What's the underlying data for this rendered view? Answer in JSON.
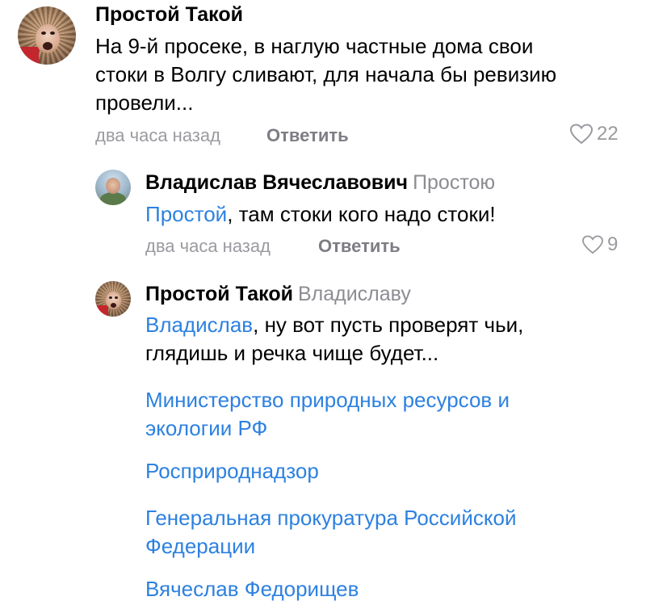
{
  "comments": [
    {
      "author": "Простой Такой",
      "text_lines": [
        "На 9-й просеке, в наглую частные дома свои",
        "стоки в Волгу сливают, для начала бы ревизию",
        "провели..."
      ],
      "time": "два часа назад",
      "reply_label": "Ответить",
      "likes": "22"
    },
    {
      "author": "Владислав Вячеславович",
      "reply_to": "Простою",
      "mention": "Простой",
      "text": ", там стоки кого надо стоки!",
      "time": "два часа назад",
      "reply_label": "Ответить",
      "likes": "9"
    },
    {
      "author": "Простой Такой",
      "reply_to": "Владиславу",
      "mention": "Владислав",
      "text_line1": ", ну вот пусть проверят чьи,",
      "text_line2": "глядишь и речка чище будет...",
      "tags": [
        {
          "line1": "Министерство природных ресурсов и",
          "line2": "экологии РФ"
        },
        {
          "line1": "Росприроднадзор"
        },
        {
          "line1": "Генеральная прокуратура Российской",
          "line2": "Федерации"
        },
        {
          "line1": "Вячеслав Федорищев"
        }
      ]
    }
  ],
  "colors": {
    "link": "#2d81e0",
    "meta": "#9a9aa0",
    "reply_button": "#7d7d84",
    "reply_to": "#8c8c93"
  },
  "icons": {
    "like": "heart-outline-icon"
  }
}
